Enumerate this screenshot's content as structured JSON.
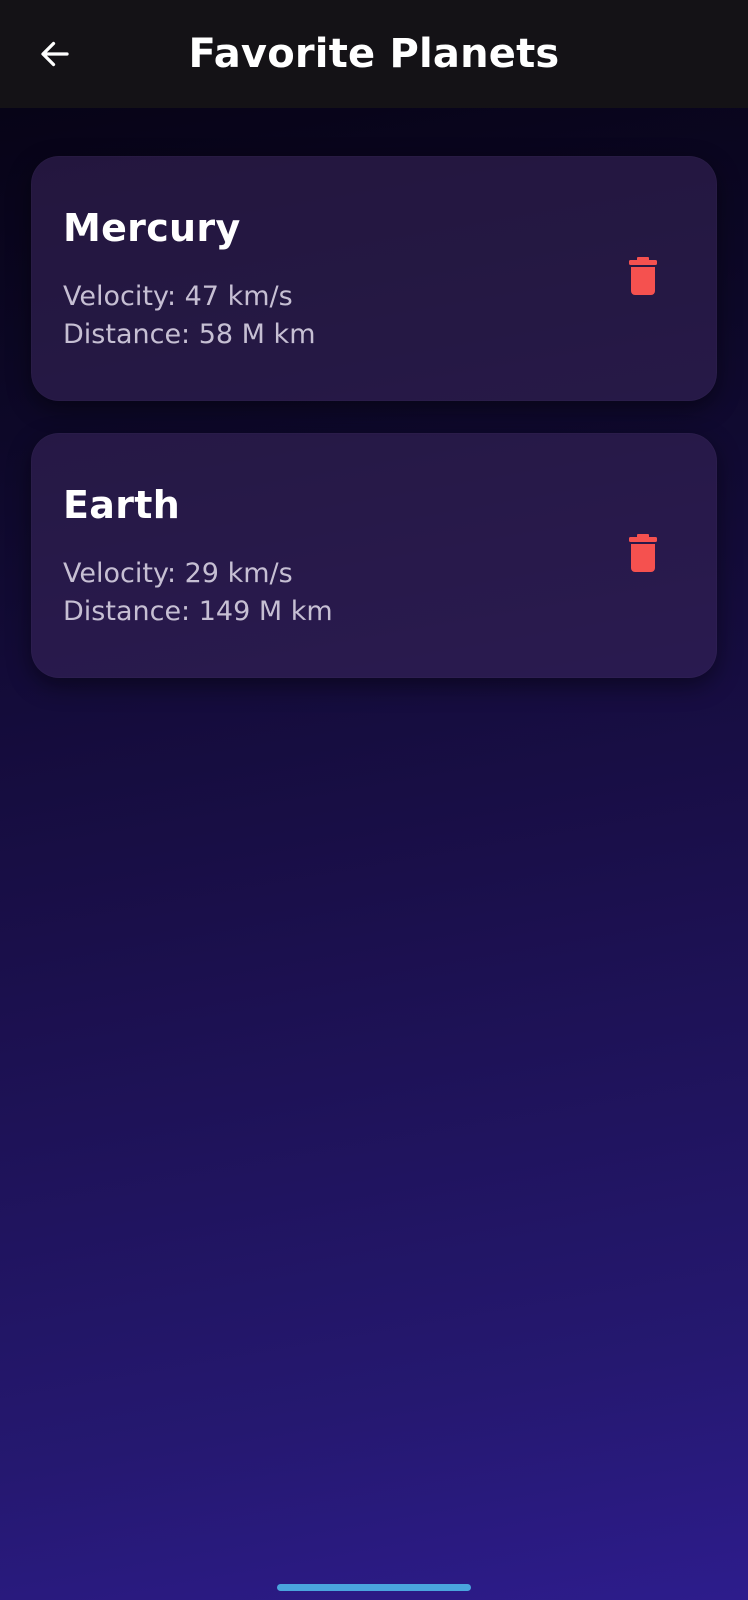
{
  "header": {
    "title": "Favorite Planets",
    "back_icon": "arrow-left-icon"
  },
  "favorites": [
    {
      "name": "Mercury",
      "velocity": "Velocity: 47 km/s",
      "distance": "Distance: 58 M km",
      "delete_icon": "trash-icon"
    },
    {
      "name": "Earth",
      "velocity": "Velocity: 29 km/s",
      "distance": "Distance: 149 M km",
      "delete_icon": "trash-icon"
    }
  ],
  "colors": {
    "app_bar": "#141216",
    "delete_red": "#f5514f",
    "card_text_secondary": "#c6bfd3",
    "home_indicator": "#4aa5de"
  }
}
